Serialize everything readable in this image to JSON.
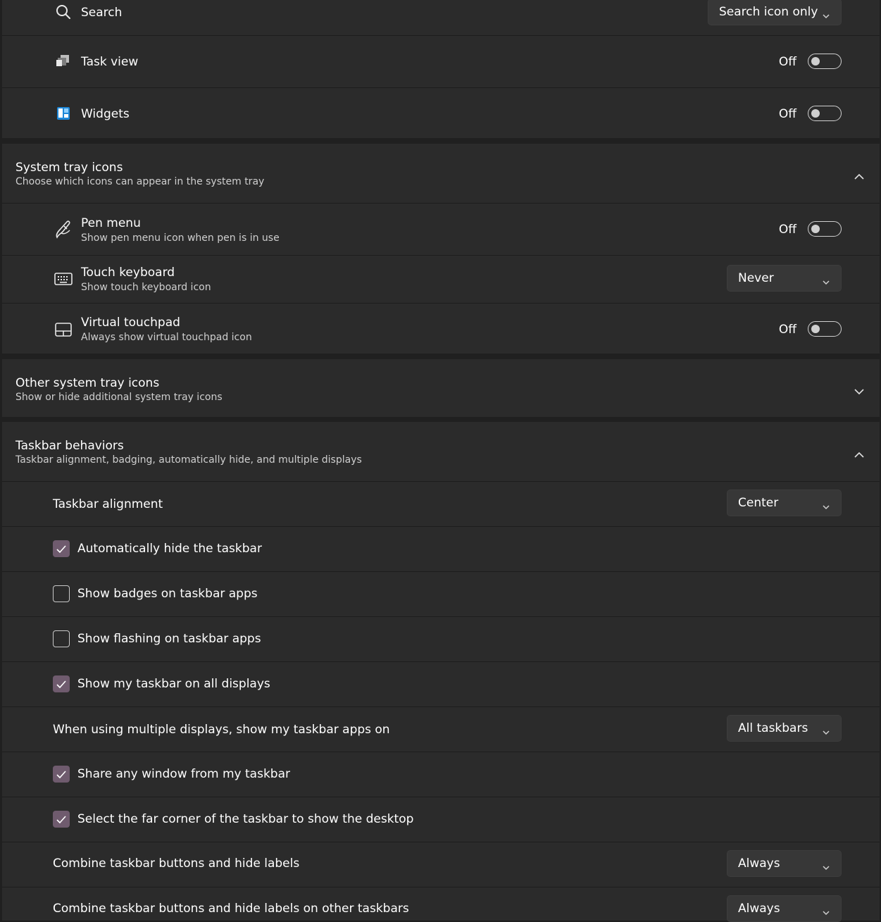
{
  "taskbar_items": {
    "search": {
      "label": "Search",
      "value": "Search icon only"
    },
    "task_view": {
      "label": "Task view",
      "state": "Off"
    },
    "widgets": {
      "label": "Widgets",
      "state": "Off"
    }
  },
  "system_tray": {
    "title": "System tray icons",
    "subtitle": "Choose which icons can appear in the system tray",
    "pen_menu": {
      "label": "Pen menu",
      "desc": "Show pen menu icon when pen is in use",
      "state": "Off"
    },
    "touch_keyboard": {
      "label": "Touch keyboard",
      "desc": "Show touch keyboard icon",
      "value": "Never"
    },
    "virtual_touchpad": {
      "label": "Virtual touchpad",
      "desc": "Always show virtual touchpad icon",
      "state": "Off"
    }
  },
  "other_tray": {
    "title": "Other system tray icons",
    "subtitle": "Show or hide additional system tray icons"
  },
  "behaviors": {
    "title": "Taskbar behaviors",
    "subtitle": "Taskbar alignment, badging, automatically hide, and multiple displays",
    "alignment": {
      "label": "Taskbar alignment",
      "value": "Center"
    },
    "auto_hide": {
      "label": "Automatically hide the taskbar",
      "checked": true
    },
    "badges": {
      "label": "Show badges on taskbar apps",
      "checked": false
    },
    "flashing": {
      "label": "Show flashing on taskbar apps",
      "checked": false
    },
    "all_displays": {
      "label": "Show my taskbar on all displays",
      "checked": true
    },
    "multi_display": {
      "label": "When using multiple displays, show my taskbar apps on",
      "value": "All taskbars"
    },
    "share_window": {
      "label": "Share any window from my taskbar",
      "checked": true
    },
    "far_corner": {
      "label": "Select the far corner of the taskbar to show the desktop",
      "checked": true
    },
    "combine": {
      "label": "Combine taskbar buttons and hide labels",
      "value": "Always"
    },
    "combine_other": {
      "label": "Combine taskbar buttons and hide labels on other taskbars",
      "value": "Always"
    }
  },
  "colors": {
    "background": "#202020",
    "card": "#2b2b2b",
    "accent_checkbox": "#6f5b6e"
  }
}
